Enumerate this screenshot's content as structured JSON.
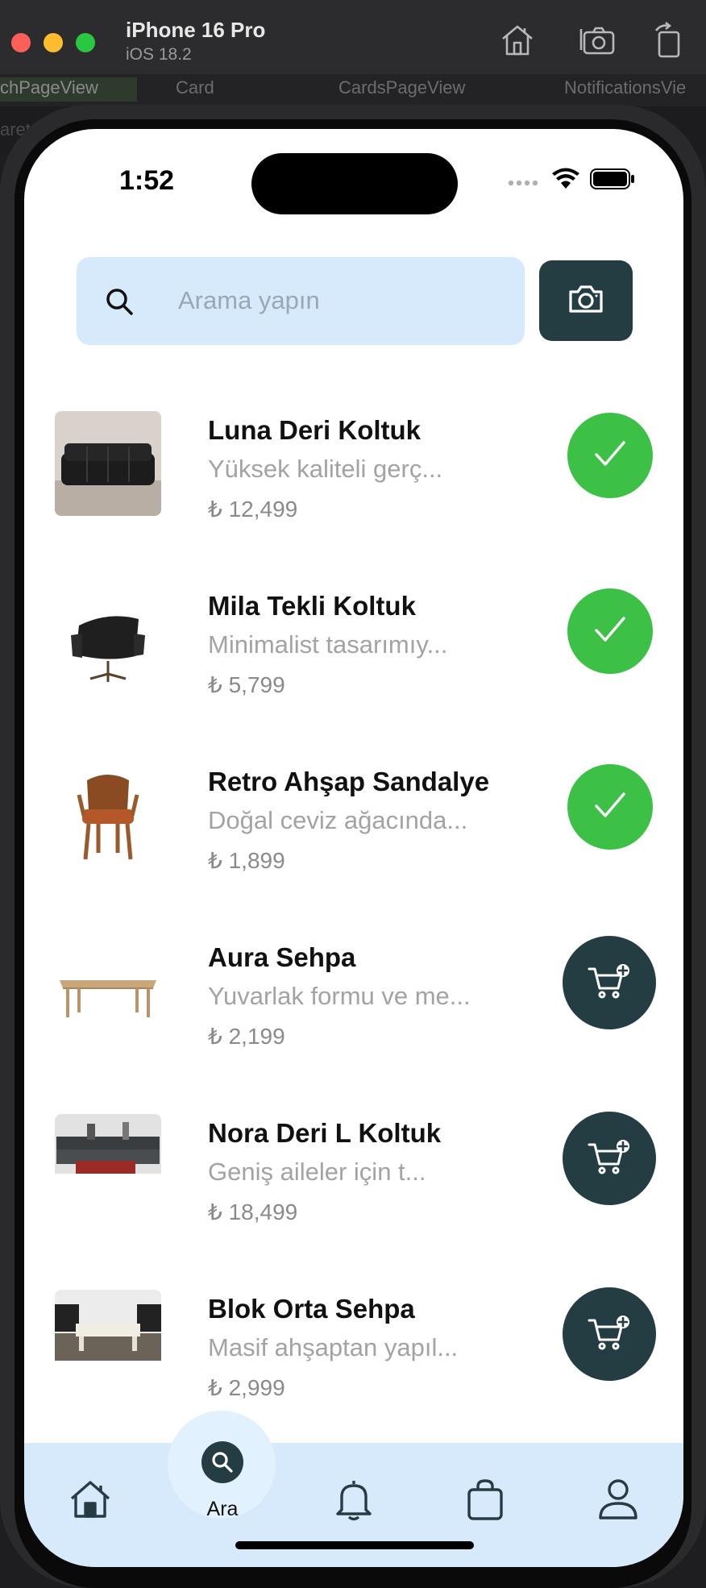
{
  "window": {
    "device_name": "iPhone 16 Pro",
    "os_version": "iOS 18.2"
  },
  "background_tabs": [
    "chPageView",
    "Card",
    "CardsPageView",
    "NotificationsVie"
  ],
  "background_text": "aretar",
  "status_bar": {
    "time": "1:52"
  },
  "search": {
    "placeholder": "Arama yapın",
    "value": ""
  },
  "products": [
    {
      "name": "Luna Deri Koltuk",
      "description": "Yüksek kaliteli gerç...",
      "price": "₺ 12,499",
      "in_cart": true
    },
    {
      "name": "Mila Tekli Koltuk",
      "description": "Minimalist tasarımıy...",
      "price": "₺ 5,799",
      "in_cart": true
    },
    {
      "name": "Retro Ahşap Sandalye",
      "description": "Doğal ceviz ağacında...",
      "price": "₺ 1,899",
      "in_cart": true
    },
    {
      "name": "Aura Sehpa",
      "description": "Yuvarlak formu ve me...",
      "price": "₺ 2,199",
      "in_cart": false
    },
    {
      "name": "Nora Deri L Koltuk",
      "description": "Geniş aileler için t...",
      "price": "₺ 18,499",
      "in_cart": false
    },
    {
      "name": "Blok Orta Sehpa",
      "description": "Masif ahşaptan yapıl...",
      "price": "₺ 2,999",
      "in_cart": false
    }
  ],
  "tabbar": {
    "active_label": "Ara",
    "items": [
      "home-icon",
      "search-icon",
      "bell-icon",
      "bag-icon",
      "person-icon"
    ]
  },
  "colors": {
    "accent_dark": "#233d43",
    "success_green": "#3cc146",
    "light_blue": "#d6eafc"
  }
}
